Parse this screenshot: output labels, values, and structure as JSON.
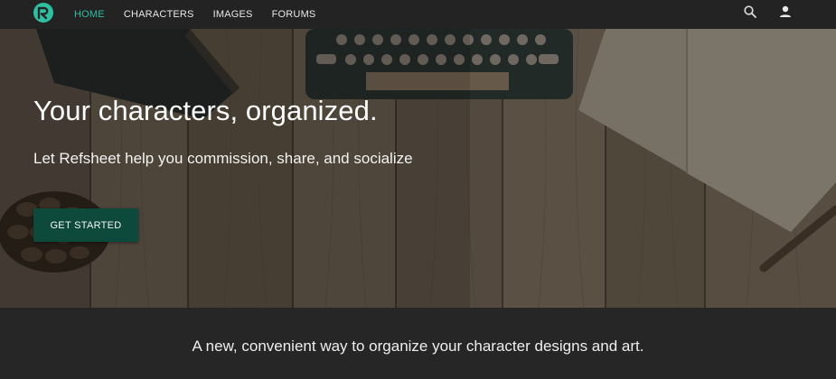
{
  "navbar": {
    "logo_icon": "refsheet-logo-icon",
    "links": [
      {
        "label": "HOME",
        "active": true
      },
      {
        "label": "CHARACTERS",
        "active": false
      },
      {
        "label": "IMAGES",
        "active": false
      },
      {
        "label": "FORUMS",
        "active": false
      }
    ],
    "search_icon": "search-icon",
    "user_icon": "user-icon",
    "active_color": "#2fbfa2"
  },
  "hero": {
    "title": "Your characters, organized.",
    "subtitle": "Let Refsheet help you commission, share, and socialize",
    "cta_label": "GET STARTED",
    "cta_color": "#0e4a3c"
  },
  "tagline": {
    "text": "A new, convenient way to organize your character designs and art."
  }
}
